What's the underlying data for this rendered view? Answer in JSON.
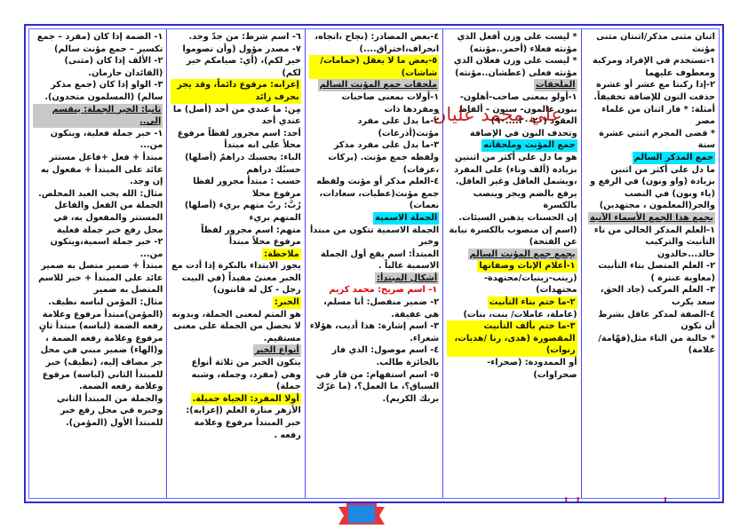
{
  "watermark": "علي محمد عليان",
  "columns": [
    [
      {
        "t": "اثنان مثنى مذكر/اثنتان مثنى مؤنث"
      },
      {
        "t": "١-تستخدم في الإفراد ومركبة ومعطوف عليهما"
      },
      {
        "t": "٢-إذا ركبتا مع عشر أو عشرة حذفت النون للإضافة تخفيفاً."
      },
      {
        "t": "أمثلة: * فاز اثنان من علماء مصر"
      },
      {
        "t": "* قضى المجرم اثنتي عشرة سنة"
      },
      {
        "t": "جمع المذكر السالم",
        "c": "hl-c"
      },
      {
        "t": "ما دل على أكثر من اثنين بزيادة (واو ونون) في الرفع و (ياء ونون) في النصب والجر(المعلمون ، مجتهدين)"
      },
      {
        "t": "يجمع هذا الجمع الأسماء الآتية",
        "c": "hl-g u"
      },
      {
        "t": "١-العلم المذكر الخالي من تاء التأنيث والتركيب خالد...خالدون"
      },
      {
        "t": "٢- العلم المتصل بتاء التأنيث (معاوية عنترة )"
      },
      {
        "t": "٣- العلم المركب (جاد الحق، سعد يكرب"
      },
      {
        "t": "٤-الصفة لمذكر عاقل بشرط أن تكون"
      },
      {
        "t": "* خالية من التاء مثل(فهّامة/علامة)"
      }
    ],
    [
      {
        "t": "* ليست على وزن أفعل الذي مؤنثه فعلاء (أحمر..مؤنثه)"
      },
      {
        "t": "* ليست على وزن فعلان الذي مؤنثه فعلى (عطشان..مؤنثه)"
      },
      {
        "t": "الملحقات",
        "c": "hl-g u"
      },
      {
        "t": "١-أولو بمعنى صاحب-أهلون- بنون عالمون- سنون - ألفاظ العقود (٢٠-٣٠....٩٠)"
      },
      {
        "t": "وتحذف النون في الإضافة"
      },
      {
        "t": "جمع المؤنث وملحقاته",
        "c": "hl-c"
      },
      {
        "t": "هو ما دل على أكثر من اثنتين بزيادة (ألف وتاء) على المفرد ،ويشمل العاقل وغير العاقل. يرفع بالضم ويجر وينصب بالكسرة"
      },
      {
        "t": "إن الحسنات يذهبن السيئات. (اسم إن منصوب بالكسرة نيابة عن الفتحة)"
      },
      {
        "t": "يجمع جمع المؤنث السالم",
        "c": "hl-g u"
      },
      {
        "t": "١-أعلام الإناث وصفاتها",
        "c": "hl-y"
      },
      {
        "t": "(زينب-زينبات/مجتهدة-مجتهدات)"
      },
      {
        "t": "٢-ما ختم بتاء التأنيث",
        "c": "hl-y"
      },
      {
        "t": "(عاملة، عاملات/ بنت، بنات)"
      },
      {
        "t": "٣-ما ختم بألف التأنيث المقصورة (هدى، رنا /هديات، رنوات)",
        "c": "hl-y"
      },
      {
        "t": "أو الممدودة: (صحراء-صحراوات)"
      }
    ],
    [
      {
        "t": "٤-بعض المصادر: (نجاح ،اتجاه، انحراف،اختراق....)"
      },
      {
        "t": "٥-بعض ما لا يعقل (حمامات/شاشات)",
        "c": "hl-y"
      },
      {
        "t": "ملحقات جمع المؤنث السالم",
        "c": "hl-g u"
      },
      {
        "t": "١-أولات بمعنى صاحبات ومفردها ذات"
      },
      {
        "t": "٢-ما يدل على مفرد مؤنث(أذرعات)"
      },
      {
        "t": "٣-ما يدل على مفرد مذكر ولفظه جمع مؤنث. (بركات ،عرفات)"
      },
      {
        "t": "٤-العلم مذكر أو مؤنث ولفظه جمع مؤنث(عطيات، سعادات، نعمات)"
      },
      {
        "t": "الجملة الاسمية",
        "c": "hl-c"
      },
      {
        "t": "الجملة الاسمية تتكون من مبتدأ وخبر"
      },
      {
        "t": "المبتدأ: اسم يقع أول الجملة الاسمية غالباً ."
      },
      {
        "t": "أشكال المبتدأ:",
        "c": "hl-g u"
      },
      {
        "t": "١- اسم صريح: محمد كريم",
        "c": "red"
      },
      {
        "t": "٢- ضمير منفصل: أنا مسلم، هي عفيفة."
      },
      {
        "t": "٣- اسم إشارة: هذا أديب، هؤلاء شعراء."
      },
      {
        "t": "٤- اسم موصول: الذي فاز بالجائزة طالب."
      },
      {
        "t": "٥- اسم استفهام: من فاز في السباق؟، ما العمل؟، (ما غرّك بربك الكريم)."
      }
    ],
    [
      {
        "t": "٦- اسم شرط: من جدّ وجد."
      },
      {
        "t": "٧- مصدر مؤول (وأن تصوموا خير لكم)، (أي: صيامكم خير لكم)"
      },
      {
        "t": "إعرابه: مرفوع دائماً، وقد يجر بحرف زائد",
        "c": "hl-y"
      },
      {
        "t": "مِن: ما عندي من أحد (أصل) ما عندي أحد"
      },
      {
        "t": "أحد: اسم مجرور لفظاً مرفوع محلاً على انه مبتدأ"
      },
      {
        "t": "الباء: بحسبك دراهمٌ (أصلها) حسبُك دراهم"
      },
      {
        "t": "حسب : مبتدأ مجرور لفظا مرفوع محلا"
      },
      {
        "t": "رُبَّ: ربّ متهم بريء (أصلها) المتهم بريء"
      },
      {
        "t": "متهم: اسم مجرور لفظاً مرفوع محلاً مبتدأ"
      },
      {
        "t": "ملاحظة:",
        "c": "hl-y"
      },
      {
        "t": "يجوز الابتداء بالنكرة إذا أدت مع الخبر معنىً مفيداً (في البيت رجل - كل له قانتون)"
      },
      {
        "t": "الخبر:",
        "c": "hl-y"
      },
      {
        "t": "هو المتم لمعنى الجملة، وبدونه لا نحصل من الجملة على معنى مستقيم."
      },
      {
        "t": "أنواع الخبر",
        "c": "hl-g u"
      },
      {
        "t": "يتكون الخبر من ثلاثة أنواع وهي (مفرد، وجملة، وشبه جملة)"
      },
      {
        "t": "أولا المفرد: الحياة جميلة.",
        "c": "hl-y"
      },
      {
        "t": "الأزهر منارة العلم (إعرابه): خبر المبتدأ مرفوع وعلامة رفعه ."
      }
    ],
    [
      {
        "t": "١- الضمة إذا كان (مفرد – جمع تكسير – جمع مؤنث سالم)"
      },
      {
        "t": "٢- الألف إذا كان (مثنى) (القائدان حازمان."
      },
      {
        "t": "٣- الواو إذا كان (جمع مذكر سالم) (المسلمون متحدون)."
      },
      {
        "t": "ثانيا: الخبر الجملة: ينقسم إلى..",
        "c": "hl-g u"
      },
      {
        "t": "١- خبر جملة فعلية، ويتكون من..."
      },
      {
        "t": "مبتدأ + فعل +فاعل مستتر عائد على المبتدأ + مفعول به إن وجد."
      },
      {
        "t": "مثال: الله يحب العبد المخلص."
      },
      {
        "t": "الجملة من الفعل والفاعل المستتر والمفعول به، في محل رفع خبر جملة فعلية"
      },
      {
        "t": "٢- خبر جملة اسمية،ويتكون من..."
      },
      {
        "t": "مبتدأ + ضمير متصل به ضمير عائد على المبتدأ + خبر للاسم المتصل به ضمير"
      },
      {
        "t": "مثال: المؤمن لباسه نظيف."
      },
      {
        "t": "(المؤمن)مبتدأ مرفوع وعلامة رفعه الضمة (لباسه) مبتدأ ثانٍ مرفوع وعلامة رفعه الضمة ،"
      },
      {
        "t": "و(الهاء) ضمير مبني في محل جر مضاف إليه، (نظيف) خبر للمبتدأ الثاني (لباسه) مرفوع وعلامة رفعه الضمة."
      },
      {
        "t": "والجملة من المبتدأ الثاني وخبره في محل رفع خبر للمبتدأ الأول (المؤمن)."
      }
    ]
  ]
}
